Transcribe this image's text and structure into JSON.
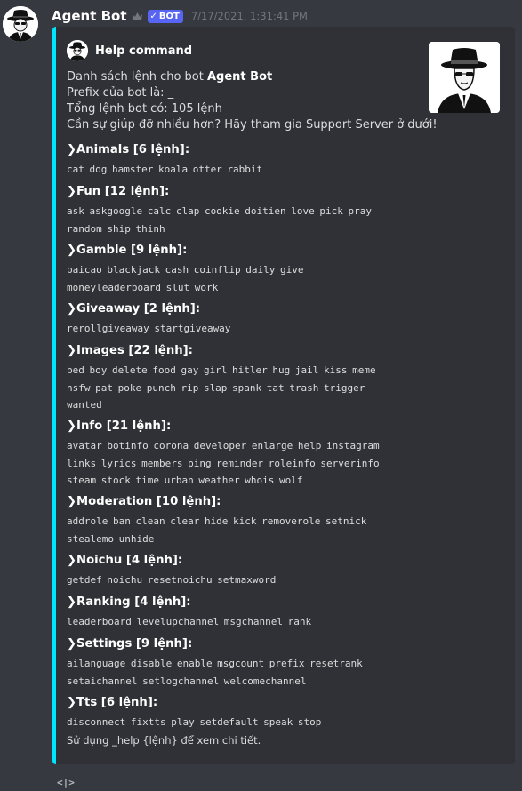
{
  "message": {
    "username": "Agent Bot",
    "badge": "BOT",
    "timestamp": "7/17/2021, 1:31:41 PM"
  },
  "embed": {
    "accent_color": "#00e5ff",
    "author": "Help command",
    "desc_line1_prefix": "Danh sách lệnh cho bot ",
    "desc_line1_bold": "Agent Bot",
    "desc_line2": "Prefix của bot là: _",
    "desc_line3": "Tổng lệnh bot có: 105 lệnh",
    "desc_line4": "Cần sự giúp đỡ nhiều hơn? Hãy tham gia Support Server ở dưới!",
    "fields": [
      {
        "name": "❯Animals [6 lệnh]:",
        "lines": [
          "cat dog hamster koala otter rabbit"
        ]
      },
      {
        "name": "❯Fun [12 lệnh]:",
        "lines": [
          "ask askgoogle calc clap cookie doitien love pick pray",
          "random ship thinh"
        ]
      },
      {
        "name": "❯Gamble [9 lệnh]:",
        "lines": [
          "baicao blackjack cash coinflip daily give",
          "moneyleaderboard slut work"
        ]
      },
      {
        "name": "❯Giveaway [2 lệnh]:",
        "lines": [
          "rerollgiveaway startgiveaway"
        ]
      },
      {
        "name": "❯Images [22 lệnh]:",
        "lines": [
          "bed boy delete food gay girl hitler hug jail kiss meme",
          "nsfw pat poke punch rip slap spank tat trash trigger",
          "wanted"
        ]
      },
      {
        "name": "❯Info [21 lệnh]:",
        "lines": [
          "avatar botinfo corona developer enlarge help instagram",
          "links lyrics members ping reminder roleinfo serverinfo",
          "steam stock time urban weather whois wolf"
        ]
      },
      {
        "name": "❯Moderation [10 lệnh]:",
        "lines": [
          "addrole ban clean clear hide kick removerole setnick",
          "stealemo unhide"
        ]
      },
      {
        "name": "❯Noichu [4 lệnh]:",
        "lines": [
          "getdef noichu resetnoichu setmaxword"
        ]
      },
      {
        "name": "❯Ranking [4 lệnh]:",
        "lines": [
          "leaderboard levelupchannel msgchannel rank"
        ]
      },
      {
        "name": "❯Settings [9 lệnh]:",
        "lines": [
          "ailanguage disable enable msgcount prefix resetrank",
          "setaichannel setlogchannel welcomechannel"
        ]
      },
      {
        "name": "❯Tts [6 lệnh]:",
        "lines": [
          "disconnect fixtts play setdefault speak stop"
        ]
      }
    ],
    "footer": "Sử dụng _help {lệnh} để xem chi tiết."
  },
  "composer": {
    "code_icon_label": "<|>"
  }
}
